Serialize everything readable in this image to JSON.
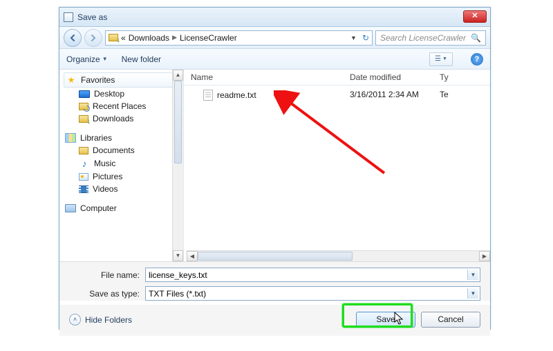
{
  "window": {
    "title": "Save as"
  },
  "nav": {
    "crumb1": "Downloads",
    "crumb2": "LicenseCrawler",
    "search_placeholder": "Search LicenseCrawler"
  },
  "toolbar": {
    "organize": "Organize",
    "newfolder": "New folder"
  },
  "tree": {
    "favorites": "Favorites",
    "desktop": "Desktop",
    "recent": "Recent Places",
    "downloads": "Downloads",
    "libraries": "Libraries",
    "documents": "Documents",
    "music": "Music",
    "pictures": "Pictures",
    "videos": "Videos",
    "computer": "Computer"
  },
  "columns": {
    "name": "Name",
    "date": "Date modified",
    "type": "Ty"
  },
  "files": [
    {
      "name": "readme.txt",
      "date": "3/16/2011 2:34 AM",
      "type": "Te"
    }
  ],
  "form": {
    "filename_label": "File name:",
    "filename_value": "license_keys.txt",
    "savetype_label": "Save as type:",
    "savetype_value": "TXT Files (*.txt)"
  },
  "footer": {
    "hide": "Hide Folders",
    "save": "Save",
    "cancel": "Cancel"
  }
}
